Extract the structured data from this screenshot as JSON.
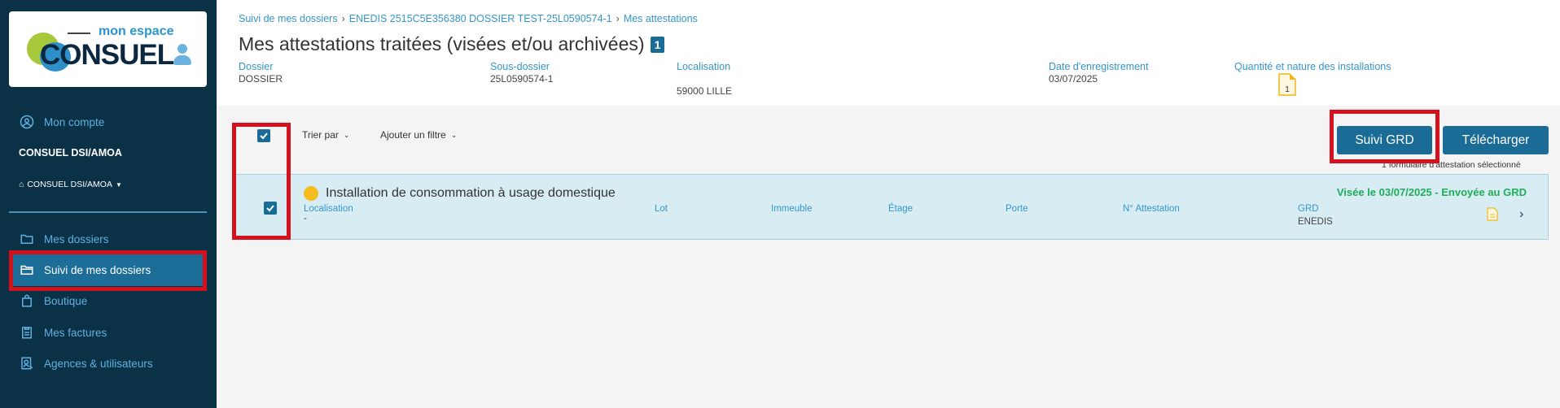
{
  "logo": {
    "subtitle": "mon espace",
    "brand": "CONSUEL"
  },
  "sidebar": {
    "account_link": "Mon compte",
    "account_name": "CONSUEL DSI/AMOA",
    "agency": "CONSUEL DSI/AMOA",
    "items": [
      {
        "label": "Mes dossiers",
        "icon": "folder-icon"
      },
      {
        "label": "Suivi de mes dossiers",
        "icon": "folder-open-icon",
        "active": true
      },
      {
        "label": "Boutique",
        "icon": "shopping-bag-icon"
      },
      {
        "label": "Mes factures",
        "icon": "clipboard-icon"
      },
      {
        "label": "Agences & utilisateurs",
        "icon": "user-badge-icon"
      }
    ]
  },
  "breadcrumb": [
    "Suivi de mes dossiers",
    "ENEDIS 2515C5E356380 DOSSIER TEST-25L0590574-1",
    "Mes attestations"
  ],
  "page": {
    "title": "Mes attestations traitées (visées et/ou archivées)",
    "count": "1"
  },
  "info": {
    "dossier_label": "Dossier",
    "dossier_value": "DOSSIER",
    "sous_dossier_label": "Sous-dossier",
    "sous_dossier_value": "25L0590574-1",
    "localisation_label": "Localisation",
    "localisation_value": "59000 LILLE",
    "date_label": "Date d'enregistrement",
    "date_value": "03/07/2025",
    "quantite_label": "Quantité et nature des installations",
    "quantite_value": "1"
  },
  "toolbar": {
    "sort_label": "Trier par",
    "filter_label": "Ajouter un filtre",
    "suivi_grd_button": "Suivi GRD",
    "download_button": "Télécharger",
    "selected_count": "1 formulaire d'attestation sélectionné"
  },
  "row": {
    "title": "Installation de consommation à usage domestique",
    "status": "Visée le 03/07/2025 - Envoyée au GRD",
    "localisation_label": "Localisation",
    "localisation_value": "-",
    "lot_label": "Lot",
    "immeuble_label": "Immeuble",
    "etage_label": "Étage",
    "porte_label": "Porte",
    "attestation_label": "N° Attestation",
    "grd_label": "GRD",
    "grd_value": "ENEDIS"
  },
  "colors": {
    "sidebar_bg": "#0b3147",
    "accent": "#1a6c96",
    "link": "#3596c9",
    "status_ok": "#1fad5a",
    "highlight": "#d4121e"
  }
}
